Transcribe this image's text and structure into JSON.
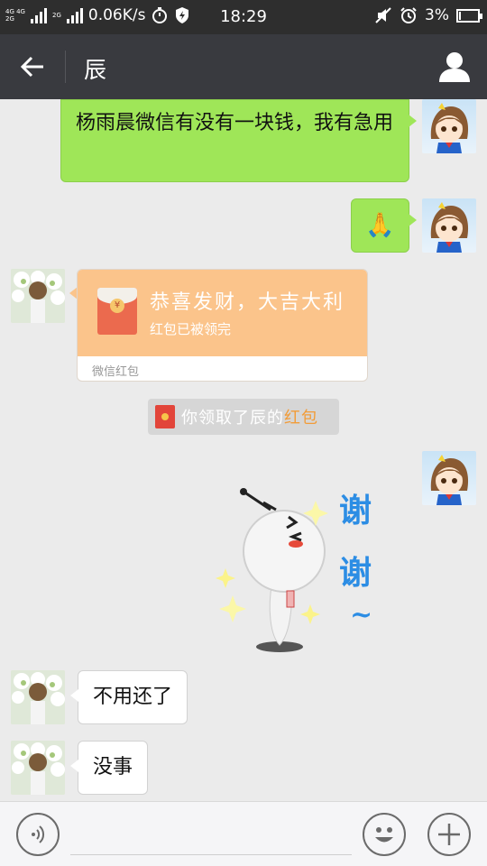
{
  "status_bar": {
    "network_top": "4G 4G",
    "network_bottom": "2G",
    "network_3": "2G",
    "speed": "0.06K/s",
    "time": "18:29",
    "battery": "3%",
    "battery_level": 0.03
  },
  "header": {
    "title": "辰"
  },
  "messages": [
    {
      "from": "me",
      "type": "text",
      "text": "杨雨晨微信有没有一块钱，我有急用"
    },
    {
      "from": "me",
      "type": "emoji",
      "text": "🙏"
    },
    {
      "from": "other",
      "type": "red_packet",
      "title": "恭喜发财，大吉大利",
      "status": "红包已被领完",
      "footer": "微信红包"
    },
    {
      "from": "system",
      "type": "notice",
      "text": "你领取了辰的",
      "link": "红包"
    },
    {
      "from": "me",
      "type": "sticker",
      "caption": [
        "谢",
        "谢",
        "~"
      ]
    },
    {
      "from": "other",
      "type": "text",
      "text": "不用还了"
    },
    {
      "from": "other",
      "type": "text",
      "text": "没事"
    }
  ],
  "colors": {
    "my_bubble": "#9fe658",
    "other_bubble": "#ffffff",
    "red_packet": "#fbc48b",
    "header_bg": "#393a3f",
    "notice_link": "#f29c38"
  },
  "icons": {
    "back": "arrow-left-icon",
    "profile": "person-icon",
    "voice": "voice-icon",
    "emoji": "smiley-icon",
    "more": "plus-icon"
  }
}
